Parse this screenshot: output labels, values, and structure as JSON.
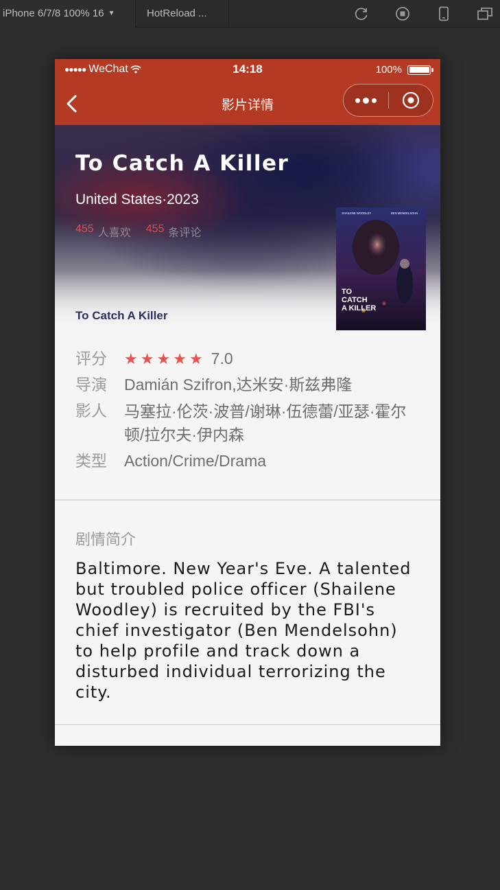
{
  "toolbar": {
    "device": "iPhone 6/7/8 100% 16",
    "tab": "HotReload ..."
  },
  "statusbar": {
    "carrier": "WeChat",
    "time": "14:18",
    "battery": "100%"
  },
  "navbar": {
    "title": "影片详情"
  },
  "movie": {
    "title": "To Catch A Killer",
    "meta": "United States·2023",
    "likes_count": "455",
    "likes_label": "人喜欢",
    "comments_count": "455",
    "comments_label": "条评论",
    "original_title": "To Catch A Killer",
    "poster": {
      "top_left": "SHAILENE WOODLEY",
      "top_right": "BEN MENDELSOHN",
      "title_lines": [
        "TO",
        "CATCH",
        "A KILLER"
      ]
    }
  },
  "info": {
    "rating_label": "评分",
    "rating_value": "7.0",
    "rating_stars": 5,
    "director_label": "导演",
    "director_value": "Damián Szifron,达米安·斯兹弗隆",
    "cast_label": "影人",
    "cast_value": "马塞拉·伦茨·波普/谢琳·伍德蕾/亚瑟·霍尔顿/拉尔夫·伊内森",
    "genre_label": "类型",
    "genre_value": "Action/Crime/Drama"
  },
  "synopsis": {
    "heading": "剧情简介",
    "text": "Baltimore. New Year's Eve. A talented but troubled police officer (Shailene Woodley) is recruited by the FBI's chief investigator (Ben Mendelsohn) to help profile and track down a disturbed individual terrorizing the city."
  },
  "colors": {
    "navbar": "#b53a23",
    "accent_red": "#e04a52",
    "star": "#e8534f"
  }
}
